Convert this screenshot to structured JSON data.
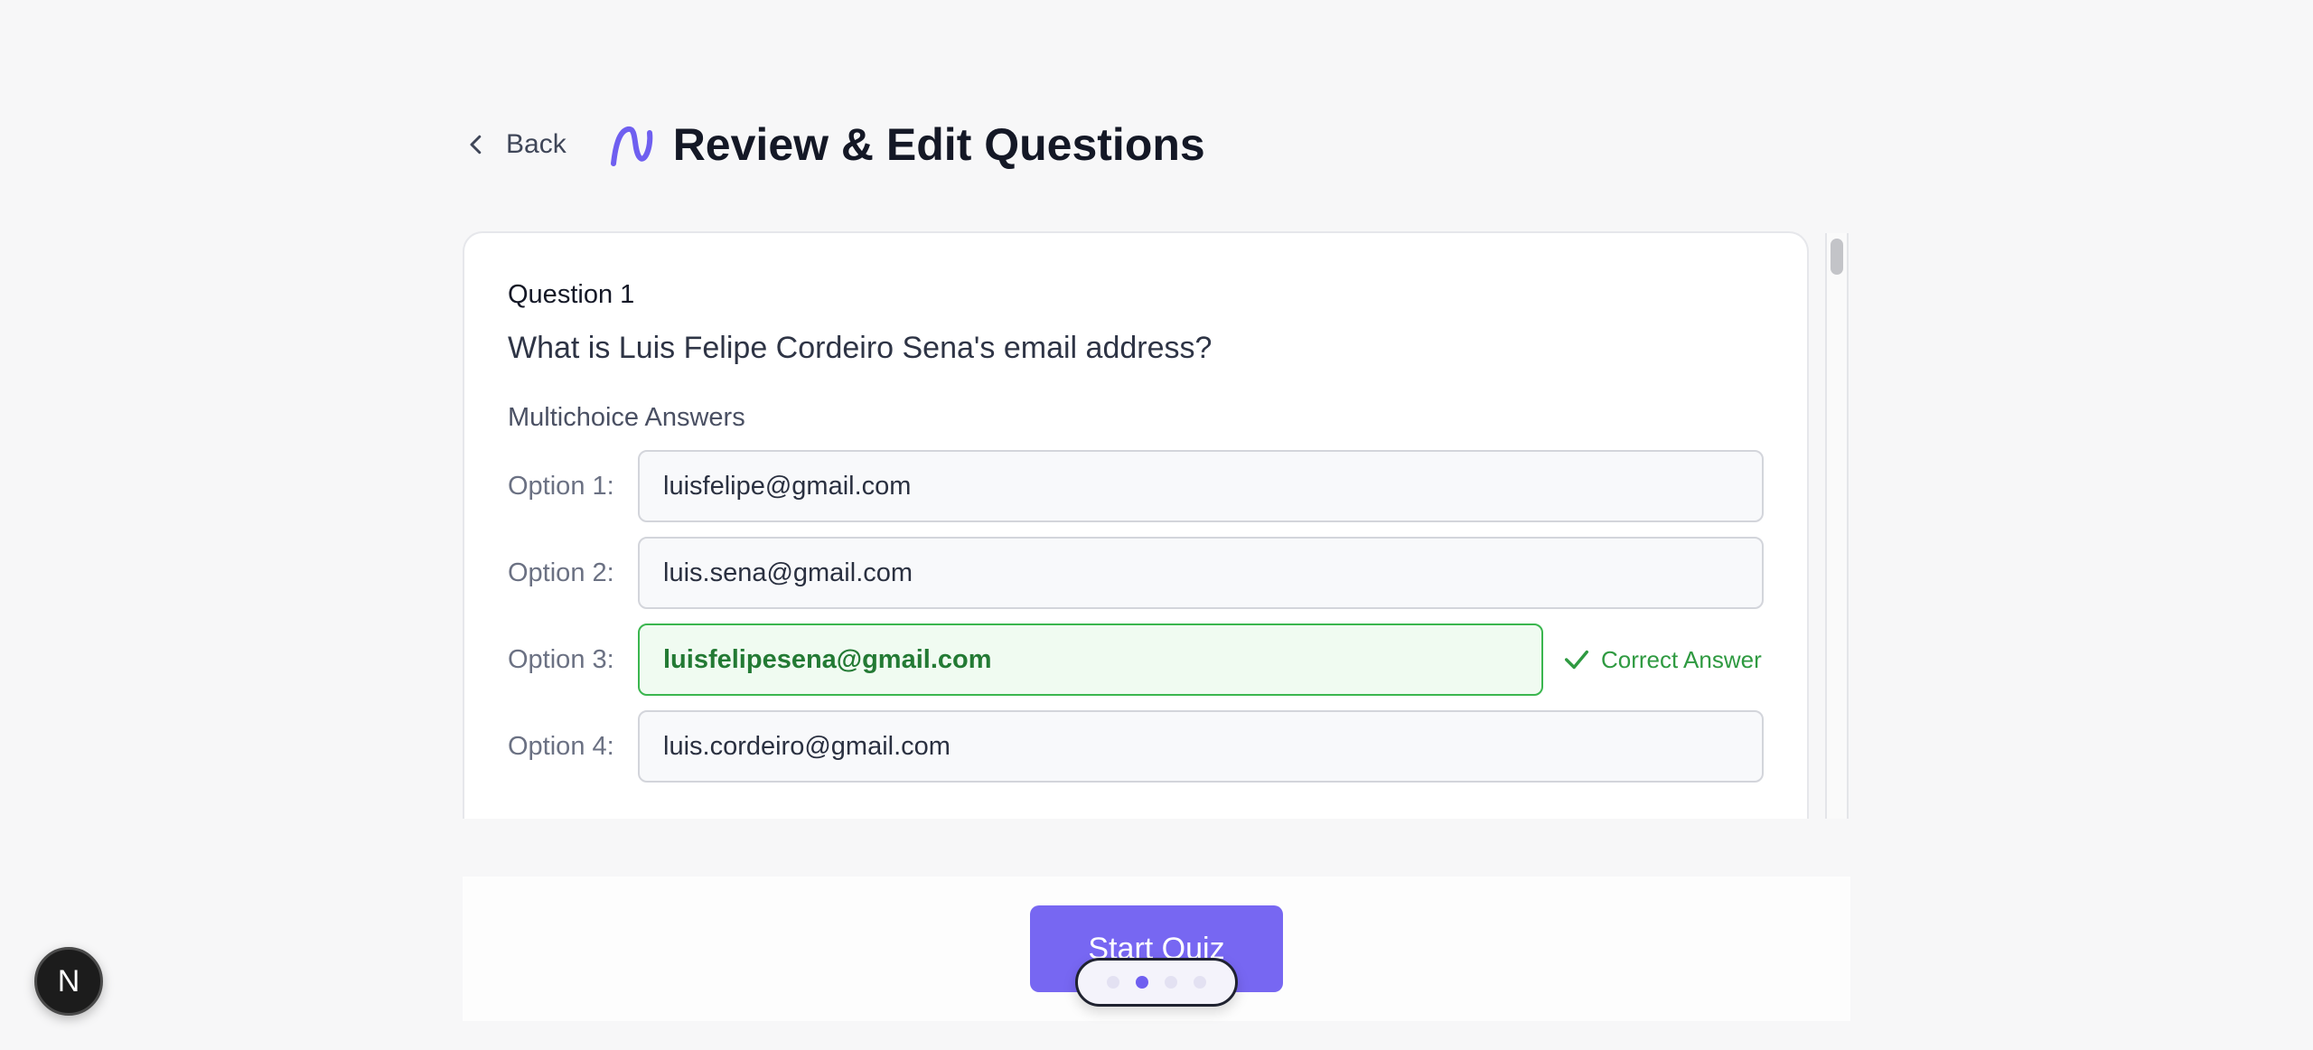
{
  "header": {
    "back_label": "Back",
    "title": "Review & Edit Questions"
  },
  "question": {
    "label": "Question 1",
    "text": "What is Luis Felipe Cordeiro Sena's email address?",
    "answers_label": "Multichoice Answers",
    "options": [
      {
        "label": "Option 1:",
        "value": "luisfelipe@gmail.com",
        "correct": false
      },
      {
        "label": "Option 2:",
        "value": "luis.sena@gmail.com",
        "correct": false
      },
      {
        "label": "Option 3:",
        "value": "luisfelipesena@gmail.com",
        "correct": true
      },
      {
        "label": "Option 4:",
        "value": "luis.cordeiro@gmail.com",
        "correct": false
      }
    ],
    "correct_tag": "Correct Answer"
  },
  "footer": {
    "start_button": "Start Quiz"
  },
  "pager": {
    "total": 4,
    "active_index": 1
  },
  "next_badge": "N",
  "colors": {
    "accent": "#7767f2",
    "correct": "#3bb64f"
  }
}
